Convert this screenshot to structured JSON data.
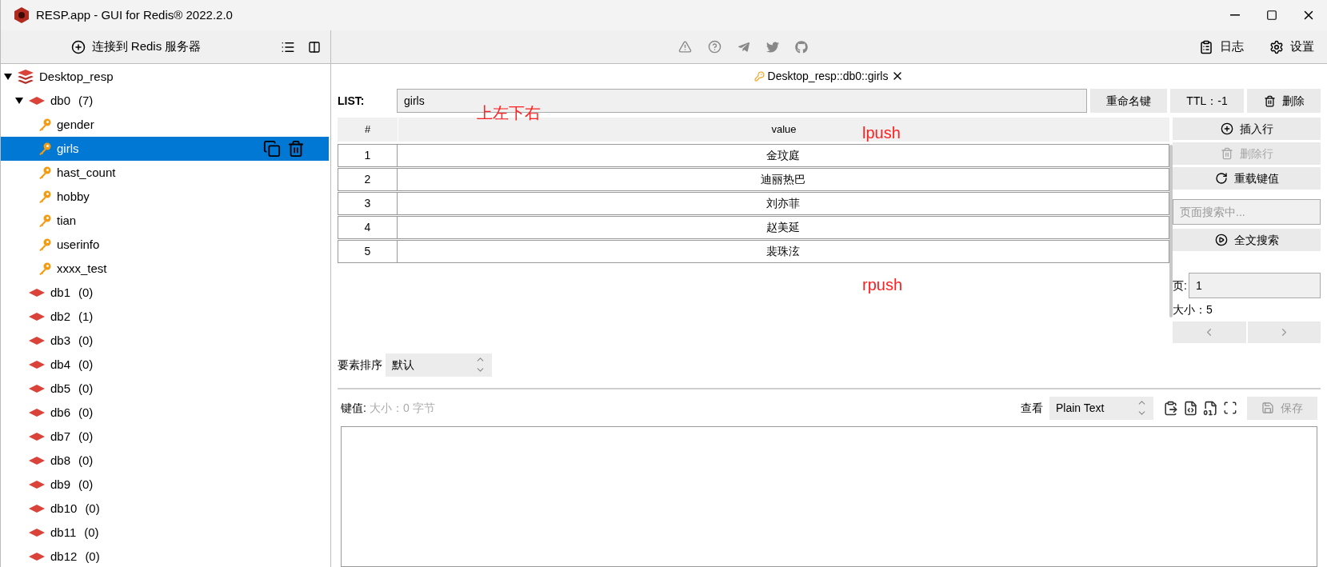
{
  "window": {
    "title": "RESP.app - GUI for Redis® 2022.2.0"
  },
  "sidebar": {
    "connect_button": "连接到 Redis 服务器"
  },
  "toolbar": {
    "log_button": "日志",
    "settings_button": "设置"
  },
  "tree": [
    {
      "kind": "connection",
      "label": "Desktop_resp",
      "expanded": true,
      "children": [
        {
          "kind": "db",
          "label": "db0",
          "count": "(7)",
          "expanded": true,
          "children": [
            {
              "kind": "key",
              "label": "gender",
              "selected": false
            },
            {
              "kind": "key",
              "label": "girls",
              "selected": true
            },
            {
              "kind": "key",
              "label": "hast_count",
              "selected": false
            },
            {
              "kind": "key",
              "label": "hobby",
              "selected": false
            },
            {
              "kind": "key",
              "label": "tian",
              "selected": false
            },
            {
              "kind": "key",
              "label": "userinfo",
              "selected": false
            },
            {
              "kind": "key",
              "label": "xxxx_test",
              "selected": false
            }
          ]
        },
        {
          "kind": "db",
          "label": "db1",
          "count": "(0)",
          "expanded": false
        },
        {
          "kind": "db",
          "label": "db2",
          "count": "(1)",
          "expanded": false
        },
        {
          "kind": "db",
          "label": "db3",
          "count": "(0)",
          "expanded": false
        },
        {
          "kind": "db",
          "label": "db4",
          "count": "(0)",
          "expanded": false
        },
        {
          "kind": "db",
          "label": "db5",
          "count": "(0)",
          "expanded": false
        },
        {
          "kind": "db",
          "label": "db6",
          "count": "(0)",
          "expanded": false
        },
        {
          "kind": "db",
          "label": "db7",
          "count": "(0)",
          "expanded": false
        },
        {
          "kind": "db",
          "label": "db8",
          "count": "(0)",
          "expanded": false
        },
        {
          "kind": "db",
          "label": "db9",
          "count": "(0)",
          "expanded": false
        },
        {
          "kind": "db",
          "label": "db10",
          "count": "(0)",
          "expanded": false
        },
        {
          "kind": "db",
          "label": "db11",
          "count": "(0)",
          "expanded": false
        },
        {
          "kind": "db",
          "label": "db12",
          "count": "(0)",
          "expanded": false
        }
      ]
    }
  ],
  "tab": {
    "label": "Desktop_resp::db0::girls"
  },
  "key_editor": {
    "type_label": "LIST:",
    "key_name": "girls",
    "rename_button": "重命名键",
    "ttl_button": "TTL：-1",
    "delete_button": "删除"
  },
  "table": {
    "columns": [
      "#",
      "value"
    ],
    "rows": [
      {
        "index": "1",
        "value": "金玟庭"
      },
      {
        "index": "2",
        "value": "迪丽热巴"
      },
      {
        "index": "3",
        "value": "刘亦菲"
      },
      {
        "index": "4",
        "value": "赵美延"
      },
      {
        "index": "5",
        "value": "裴珠泫"
      }
    ]
  },
  "side_actions": [
    {
      "label": "插入行",
      "disabled": false
    },
    {
      "label": "删除行",
      "disabled": true
    },
    {
      "label": "重载键值",
      "disabled": false
    }
  ],
  "search": {
    "placeholder": "页面搜索中..."
  },
  "full_search_button": "全文搜索",
  "pager": {
    "page_label": "页:",
    "page_value": "1",
    "size_text": "大小：5"
  },
  "sort": {
    "label": "要素排序",
    "value": "默认"
  },
  "value_panel": {
    "label": "键值:",
    "size_hint": "大小：0 字节",
    "view_label": "查看",
    "format": "Plain Text",
    "save_button": "保存",
    "save_disabled": true
  },
  "annotations": [
    {
      "text": "上左下右"
    },
    {
      "text": "lpush"
    },
    {
      "text": "rpush"
    }
  ]
}
